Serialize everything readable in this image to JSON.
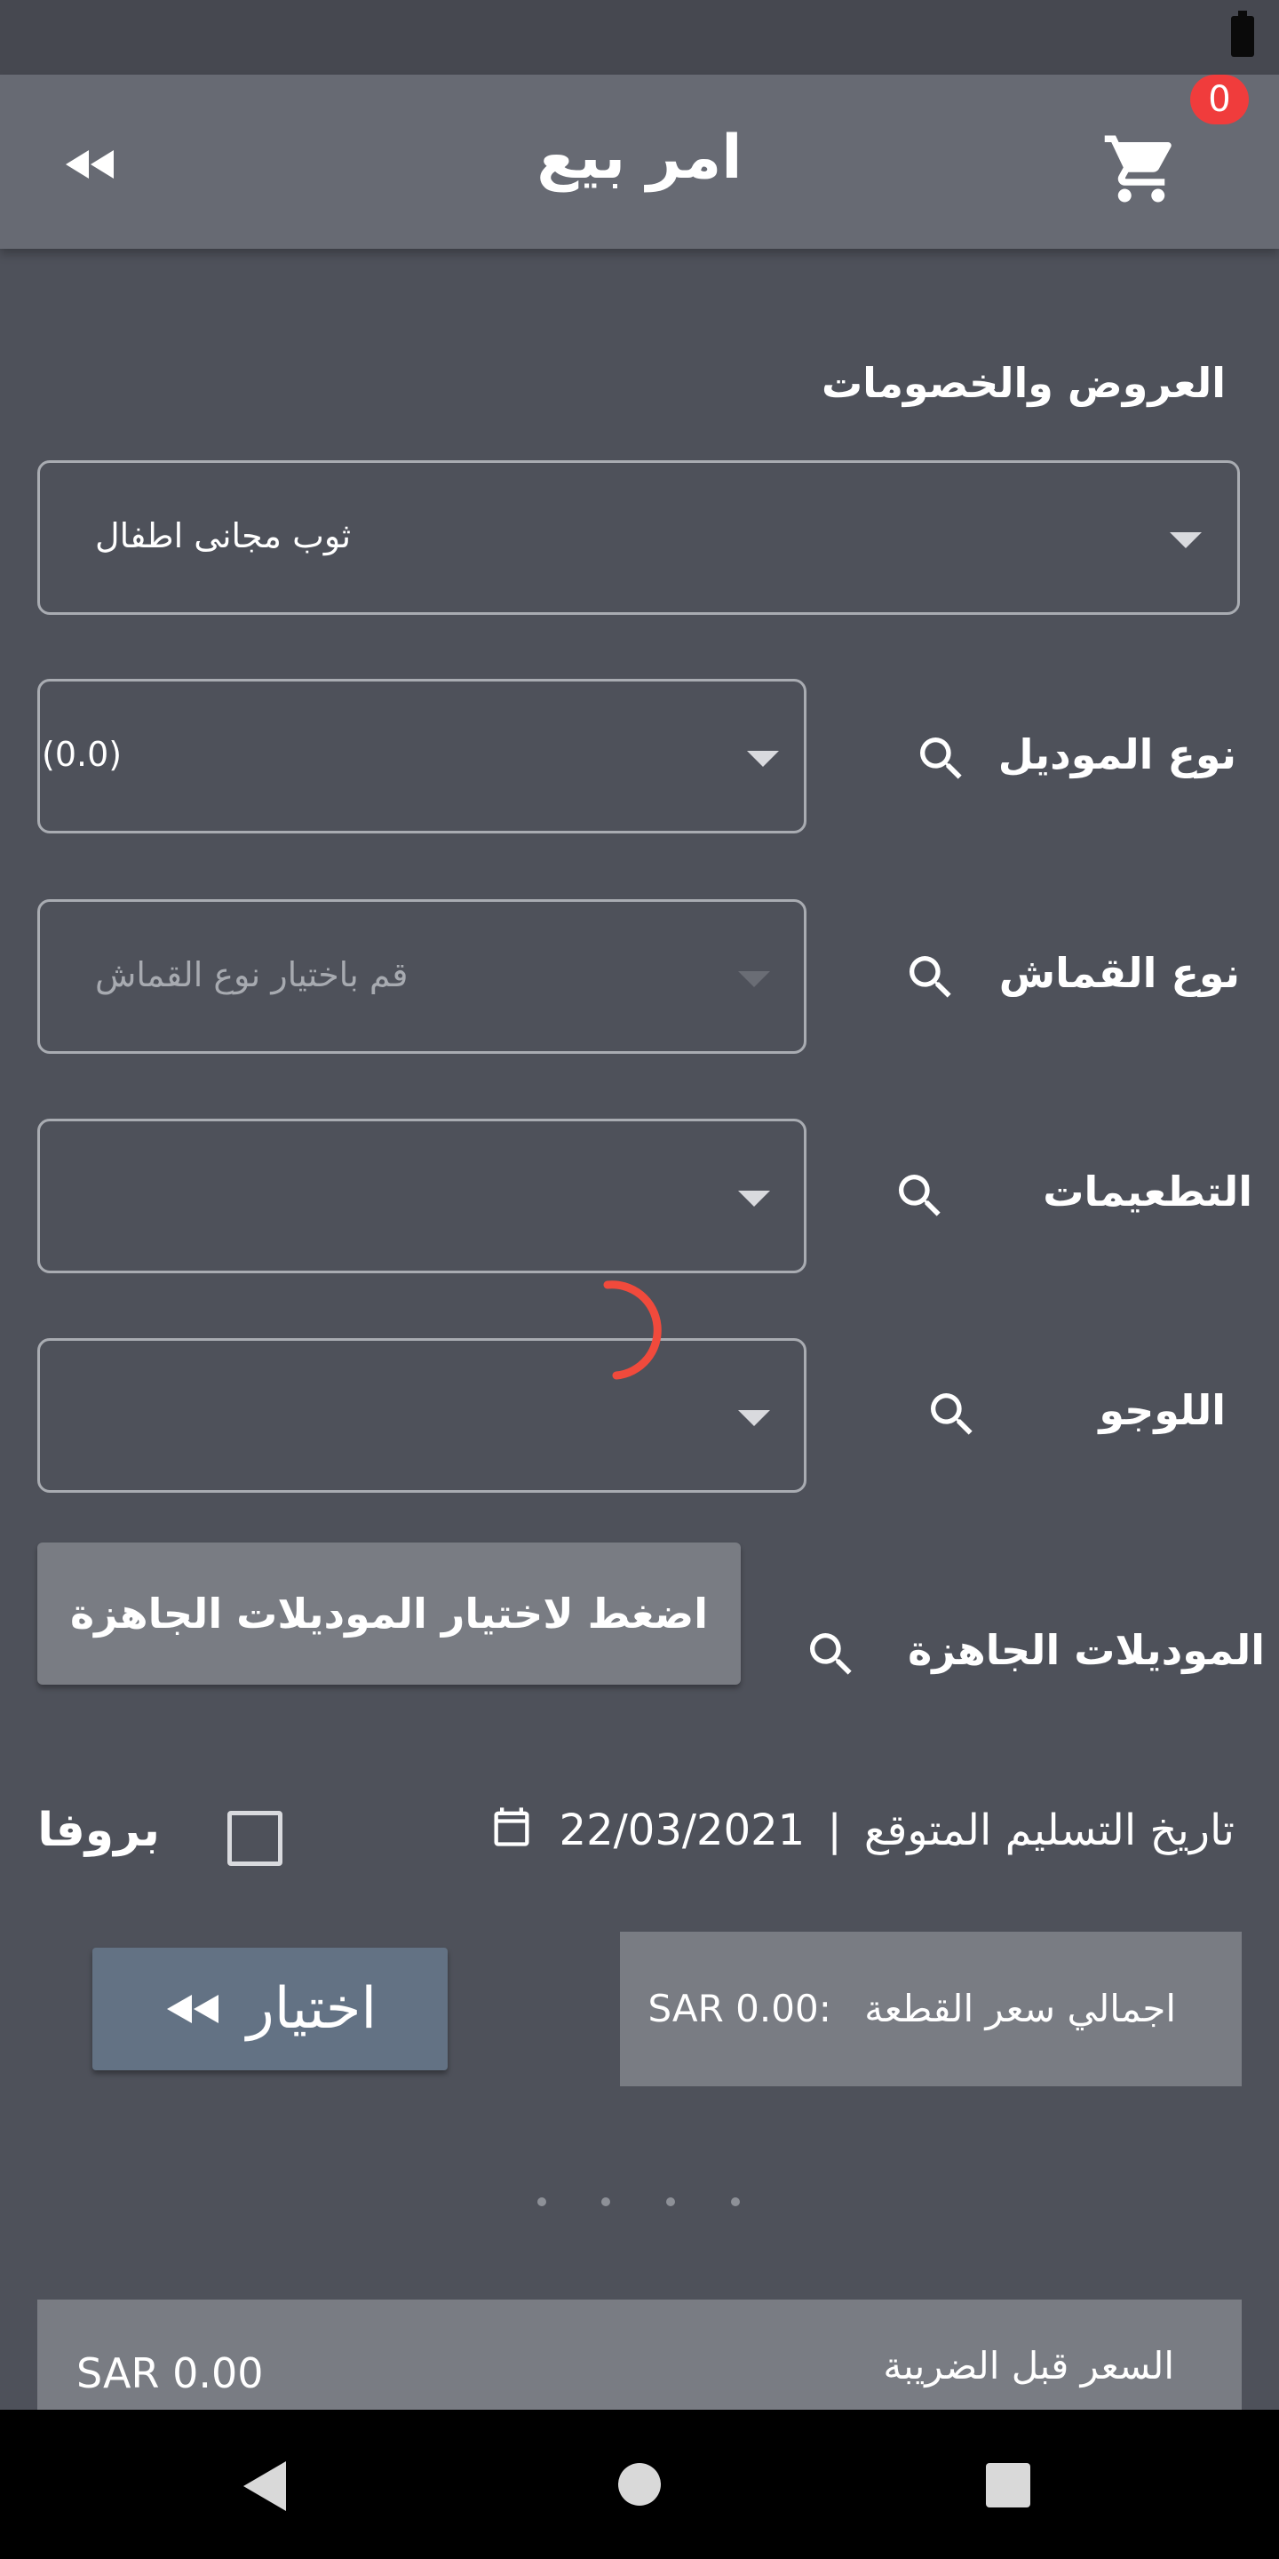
{
  "status_bar": {
    "battery_icon": "battery-icon"
  },
  "app_bar": {
    "title": "امر بيع",
    "back_icon": "double-chevron-left-icon",
    "cart_icon": "shopping-cart-icon",
    "cart_count": "0"
  },
  "offers": {
    "label": "العروض والخصومات",
    "selected": "ثوب مجانى اطفال"
  },
  "fields": {
    "model": {
      "label": "نوع الموديل",
      "value": "(0.0)"
    },
    "fabric": {
      "label": "نوع القماش",
      "placeholder": "قم باختيار نوع القماش"
    },
    "embroidery": {
      "label": "التطعيمات",
      "value": ""
    },
    "logo": {
      "label": "اللوجو",
      "value": ""
    },
    "ready_models": {
      "label": "الموديلات الجاهزة",
      "button": "اضغط لاختيار الموديلات الجاهزة"
    }
  },
  "delivery": {
    "label": "تاريخ التسليم المتوقع",
    "separator": "|",
    "date": "22/03/2021",
    "icon": "calendar-icon"
  },
  "profa": {
    "label": "بروفا",
    "checked": false
  },
  "choose_button": {
    "label": "اختيار",
    "icon": "double-chevron-left-icon"
  },
  "total_piece": {
    "label": "اجمالي سعر القطعة",
    "value": ":SAR 0.00"
  },
  "pager": {
    "dots": 4
  },
  "pretax": {
    "label": "السعر قبل الضريبة",
    "value": "SAR 0.00"
  },
  "colors": {
    "background": "#4e515a",
    "app_bar": "#676a73",
    "badge": "#f03c3c",
    "spinner": "#f04a3c",
    "button_blue": "#637284",
    "button_gray": "#797c83"
  }
}
